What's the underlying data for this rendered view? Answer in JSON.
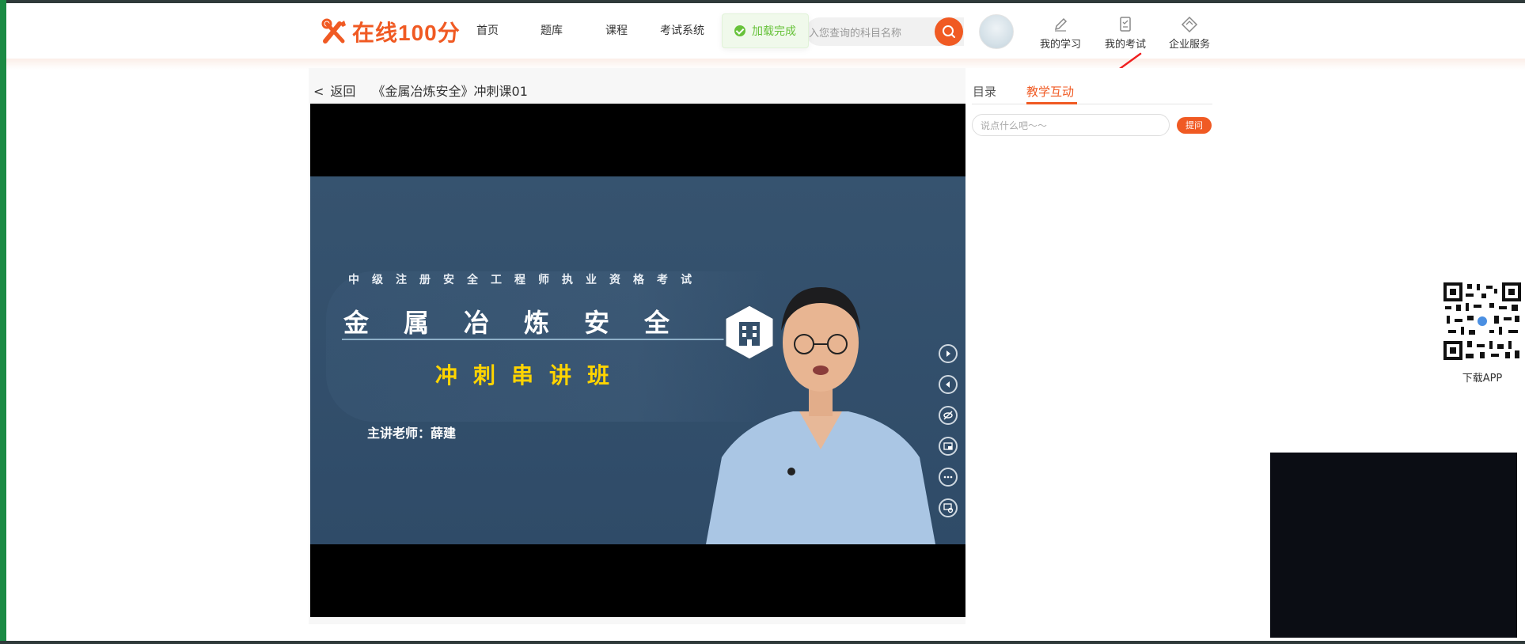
{
  "header": {
    "logo_text": "在线100分",
    "nav": [
      "首页",
      "题库",
      "课程",
      "考试系统"
    ],
    "toast": "加载完成",
    "search_placeholder": "入您查询的科目名称",
    "icons": [
      {
        "label": "我的学习",
        "icon": "pencil-icon"
      },
      {
        "label": "我的考试",
        "icon": "exam-icon"
      },
      {
        "label": "企业服务",
        "icon": "service-icon"
      }
    ]
  },
  "player": {
    "back_arrow": "<",
    "back_label": "返回",
    "course_title": "《金属冶炼安全》冲刺课01",
    "slide": {
      "line1": "中级注册安全工程师执业资格考试",
      "line2": "金属冶炼安全",
      "line3": "冲刺串讲班",
      "line4": "主讲老师：薛建"
    }
  },
  "side": {
    "tabs": [
      "目录",
      "教学互动"
    ],
    "active_tab": "教学互动",
    "input_placeholder": "说点什么吧～～",
    "ask_button": "提问"
  },
  "qr": {
    "label": "下载APP"
  },
  "colors": {
    "accent": "#f05a23",
    "success": "#67c23a",
    "slide_bg": "#34506c",
    "slide_yellow": "#ffd400"
  }
}
